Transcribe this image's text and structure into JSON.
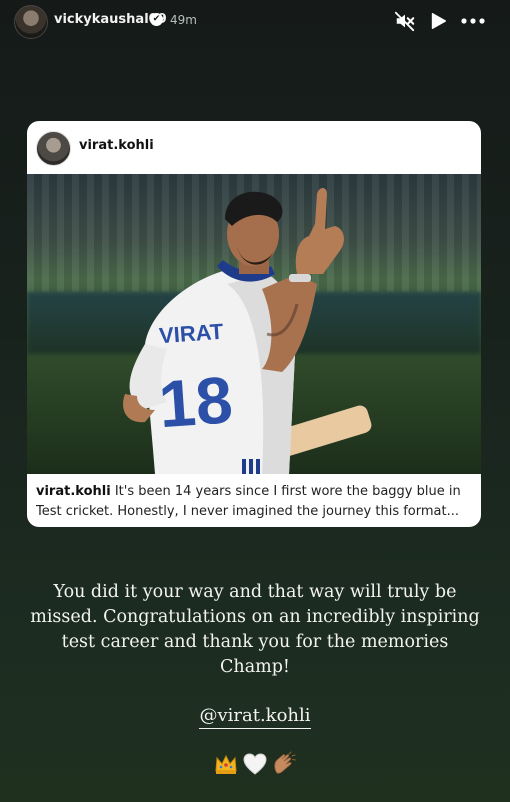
{
  "header": {
    "username": "vickykaushal09",
    "time": "49m",
    "verified_glyph": "✔",
    "icons": [
      "mute-icon",
      "play-icon",
      "more-icon"
    ]
  },
  "post": {
    "username": "virat.kohli",
    "caption_user": "virat.kohli",
    "caption_text": "It's been 14 years since I first wore the baggy blue in Test cricket. Honestly, I never imagined the journey this format...",
    "jersey_name": "VIRAT",
    "jersey_number": "18"
  },
  "story": {
    "message": "You did it your way and that way will truly be missed. Congratulations on an incredibly inspiring test career and thank you for the memories Champ!",
    "mention": "@virat.kohli",
    "emojis": [
      "crown-emoji",
      "white-heart-emoji",
      "clapping-hands-emoji"
    ]
  },
  "colors": {
    "background": "#18221d",
    "card": "#ffffff",
    "text": "#f3f3f1"
  }
}
